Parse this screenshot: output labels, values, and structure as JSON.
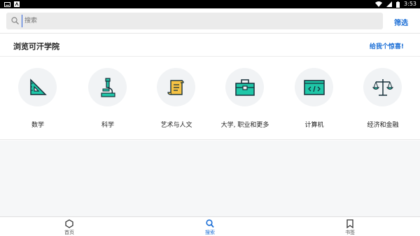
{
  "status_bar": {
    "time": "3:53"
  },
  "search": {
    "placeholder": "搜索",
    "filter_label": "筛选"
  },
  "header": {
    "title": "浏览可汗学院",
    "surprise_label": "给我个惊喜!"
  },
  "categories": [
    {
      "label": "数学",
      "icon": "ruler-triangle-icon"
    },
    {
      "label": "科学",
      "icon": "microscope-icon"
    },
    {
      "label": "艺术与人文",
      "icon": "scroll-icon"
    },
    {
      "label": "大学, 职业和更多",
      "icon": "briefcase-icon"
    },
    {
      "label": "计算机",
      "icon": "code-screen-icon"
    },
    {
      "label": "经济和金融",
      "icon": "balance-scale-icon"
    }
  ],
  "bottom_nav": [
    {
      "label": "首页",
      "icon": "home-hexagon-icon",
      "active": false
    },
    {
      "label": "搜索",
      "icon": "search-icon",
      "active": true
    },
    {
      "label": "书签",
      "icon": "bookmark-icon",
      "active": false
    }
  ],
  "colors": {
    "accent": "#1c6fd6",
    "teal": "#1fc7a8",
    "icon_bg": "#f1f3f5"
  }
}
